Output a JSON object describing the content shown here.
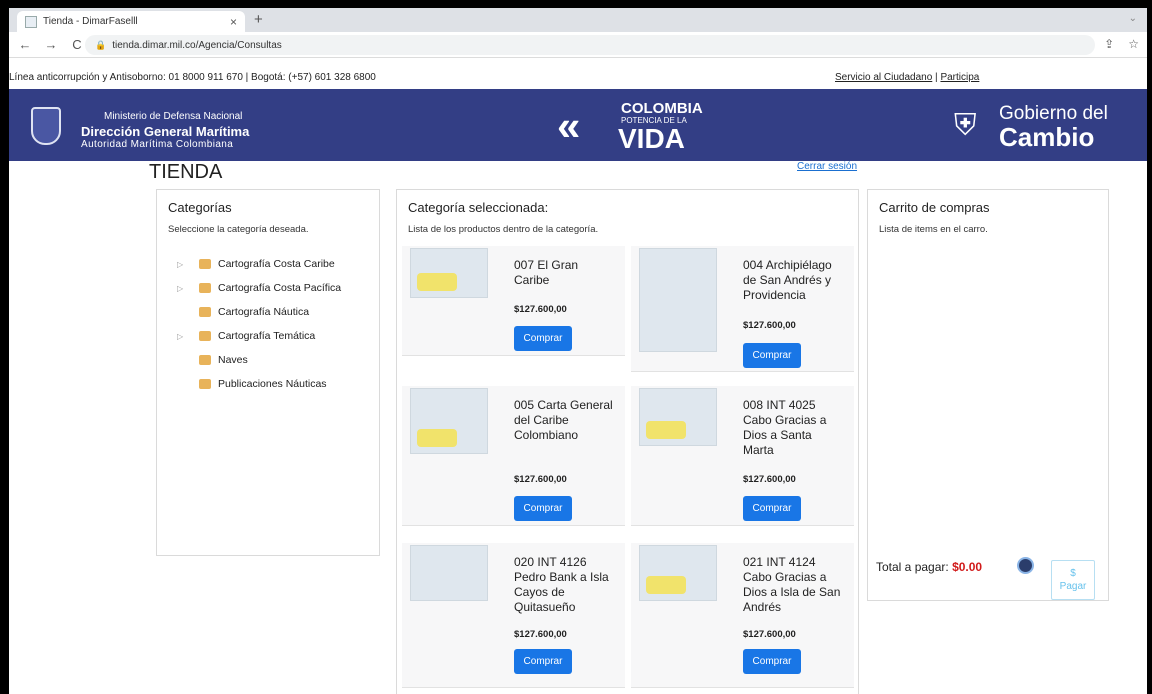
{
  "browser": {
    "tab_title": "Tienda - DimarFaselll",
    "tab_close": "×",
    "new_tab": "+",
    "back": "←",
    "forward": "→",
    "reload": "C",
    "url": "tienda.dimar.mil.co/Agencia/Consultas"
  },
  "infobar": {
    "hotline": "Línea anticorrupción y Antisoborno: 01 8000 911 670 | Bogotá: (+57) 601 328 6800",
    "servicio": "Servicio al Ciudadano",
    "separator": " | ",
    "participa": "Participa"
  },
  "header": {
    "ministerio": "Ministerio de Defensa Nacional",
    "direccion": "Dirección General Marítima",
    "autoridad": "Autoridad Marítima Colombiana",
    "colombia": "COLOMBIA",
    "potencia": "POTENCIA DE LA",
    "vida": "VIDA",
    "gobierno_del": "Gobierno del",
    "cambio": "Cambio"
  },
  "page": {
    "title": "TIENDA",
    "logout": "Cerrar sesión"
  },
  "categories": {
    "title": "Categorías",
    "subtitle": "Seleccione la categoría deseada.",
    "items": [
      {
        "label": "Cartografía Costa Caribe",
        "expandable": true
      },
      {
        "label": "Cartografía Costa Pacífica",
        "expandable": true
      },
      {
        "label": "Cartografía Náutica",
        "expandable": false
      },
      {
        "label": "Cartografía Temática",
        "expandable": true
      },
      {
        "label": "Naves",
        "expandable": false
      },
      {
        "label": "Publicaciones Náuticas",
        "expandable": false
      }
    ]
  },
  "selected": {
    "title": "Categoría seleccionada:",
    "subtitle": "Lista de los productos dentro de la categoría.",
    "buy_label": "Comprar",
    "products": [
      {
        "name": "007 El Gran Caribe",
        "price": "$127.600,00"
      },
      {
        "name": "004 Archipiélago de San Andrés y Providencia",
        "price": "$127.600,00"
      },
      {
        "name": "005 Carta General del Caribe Colombiano",
        "price": "$127.600,00"
      },
      {
        "name": "008 INT 4025 Cabo Gracias a Dios a Santa Marta",
        "price": "$127.600,00"
      },
      {
        "name": "020 INT 4126 Pedro Bank a Isla Cayos de Quitasueño",
        "price": "$127.600,00"
      },
      {
        "name": "021 INT 4124 Cabo Gracias a Dios a Isla de San Andrés",
        "price": "$127.600,00"
      }
    ]
  },
  "cart": {
    "title": "Carrito de compras",
    "subtitle": "Lista de items en el carro.",
    "total_label": "Total a pagar: ",
    "total_value": "$0.00",
    "pay_symbol": "$",
    "pay_label": "Pagar"
  },
  "colors": {
    "header_blue": "#333e85",
    "button_blue": "#1976e6",
    "total_red": "#d11a1a"
  }
}
